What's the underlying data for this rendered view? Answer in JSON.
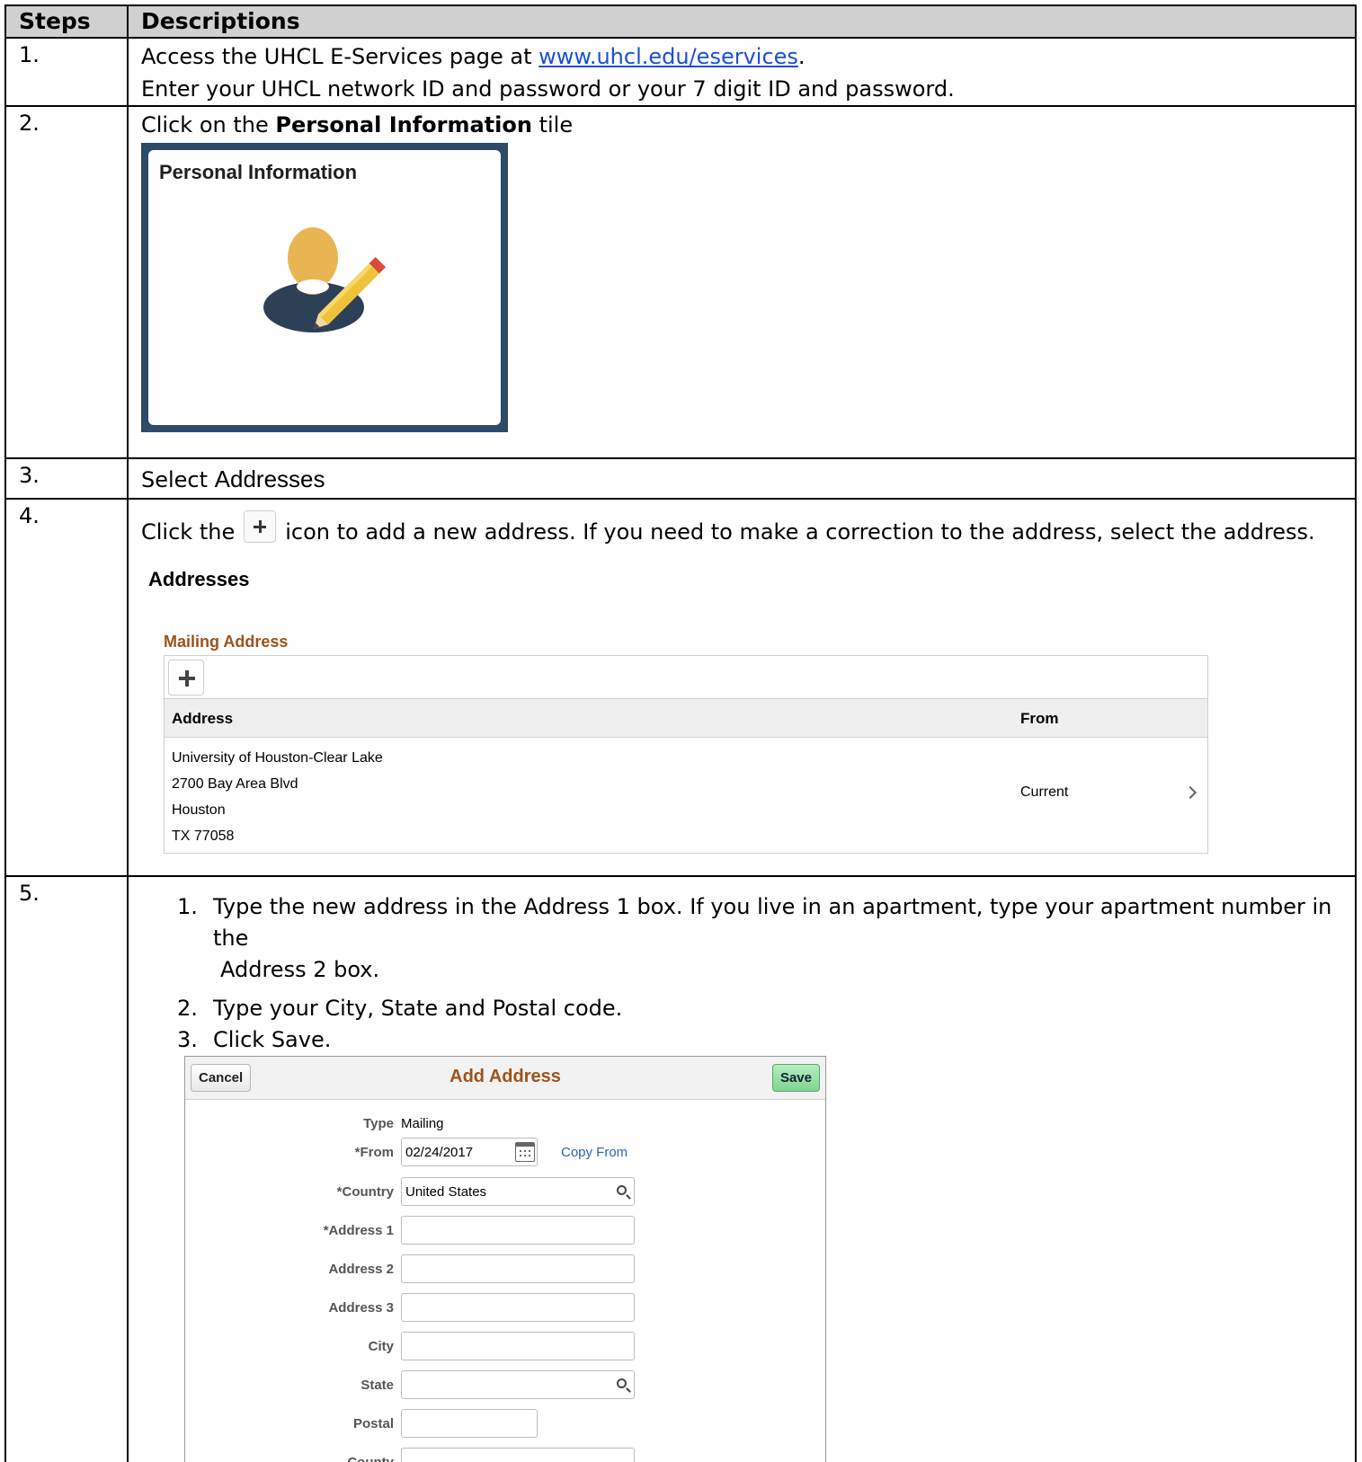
{
  "header": {
    "steps": "Steps",
    "descriptions": "Descriptions"
  },
  "step1": {
    "num": "1.",
    "line1_pre": "Access the UHCL E-Services page at ",
    "link": "www.uhcl.edu/eservices",
    "line1_post": ".",
    "line2": "Enter your UHCL network ID and password or your 7 digit ID and password."
  },
  "step2": {
    "num": "2.",
    "pre": "Click on the ",
    "bold": "Personal Information",
    "post": " tile",
    "tile_title": "Personal Information",
    "tile_icon": "person-edit-icon"
  },
  "step3": {
    "num": "3.",
    "pre": "Select ",
    "bold": "Addresses"
  },
  "step4": {
    "num": "4.",
    "pre": "Click the",
    "post": "icon to add a new address. If you need to make a correction to the address, select the address.",
    "panel_title": "Addresses",
    "section_title": "Mailing Address",
    "col_address": "Address",
    "col_from": "From",
    "address_lines": [
      "University of Houston-Clear Lake",
      "2700 Bay Area Blvd",
      "Houston",
      "TX 77058"
    ],
    "from_value": "Current"
  },
  "step5": {
    "num": "5.",
    "items": [
      {
        "n": "1.",
        "text": "Type the new address in the Address 1 box. If you live in an apartment, type your apartment number in the",
        "text2": "Address 2 box."
      },
      {
        "n": "2.",
        "text": "Type your City, State and Postal code."
      },
      {
        "n": "3.",
        "text": "Click Save."
      }
    ],
    "form": {
      "cancel": "Cancel",
      "title": "Add Address",
      "save": "Save",
      "type_label": "Type",
      "type_value": "Mailing",
      "from_label": "*From",
      "from_value": "02/24/2017",
      "copy_from": "Copy From",
      "country_label": "*Country",
      "country_value": "United States",
      "address1_label": "*Address 1",
      "address2_label": "Address 2",
      "address3_label": "Address 3",
      "city_label": "City",
      "state_label": "State",
      "postal_label": "Postal",
      "county_label": "County"
    }
  },
  "colors": {
    "link": "#1a4fd6",
    "accent": "#9c531b",
    "tile_border": "#2d4a66",
    "save": "#7fd48f"
  }
}
